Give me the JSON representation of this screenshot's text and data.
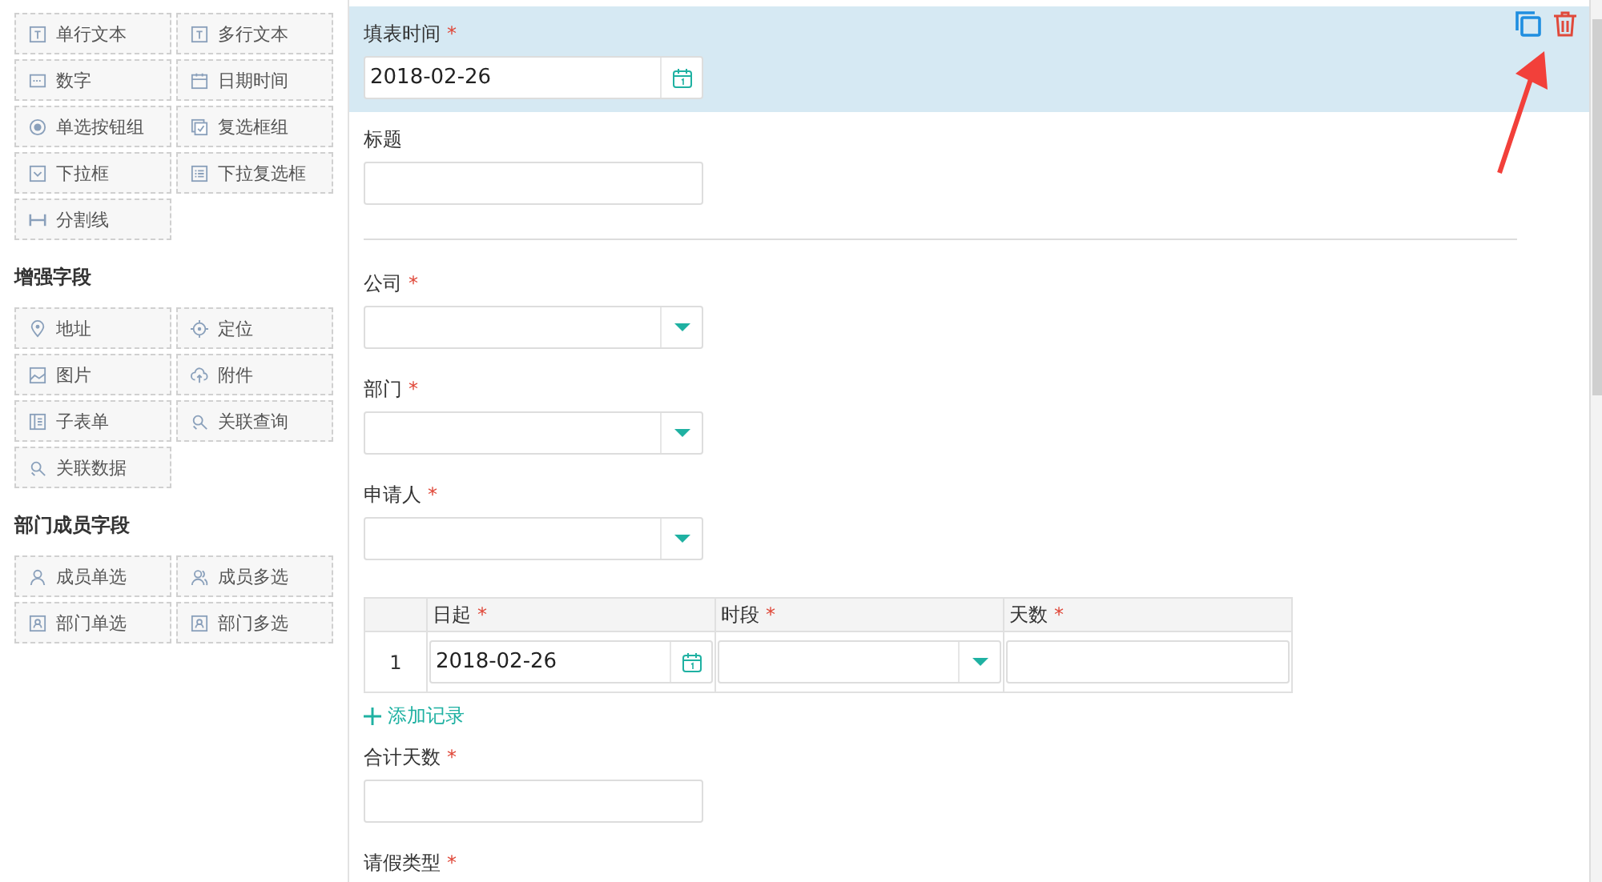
{
  "palette": [
    {
      "items": [
        {
          "label": "单行文本"
        },
        {
          "label": "多行文本"
        },
        {
          "label": "数字"
        },
        {
          "label": "日期时间"
        },
        {
          "label": "单选按钮组"
        },
        {
          "label": "复选框组"
        },
        {
          "label": "下拉框"
        },
        {
          "label": "下拉复选框"
        },
        {
          "label": "分割线"
        }
      ]
    },
    {
      "title": "增强字段",
      "items": [
        {
          "label": "地址"
        },
        {
          "label": "定位"
        },
        {
          "label": "图片"
        },
        {
          "label": "附件"
        },
        {
          "label": "子表单"
        },
        {
          "label": "关联查询"
        },
        {
          "label": "关联数据"
        }
      ]
    },
    {
      "title": "部门成员字段",
      "items": [
        {
          "label": "成员单选"
        },
        {
          "label": "成员多选"
        },
        {
          "label": "部门单选"
        },
        {
          "label": "部门多选"
        }
      ]
    }
  ],
  "form": [
    {
      "kind": "date",
      "label": "填表时间",
      "required_mark": "*",
      "value": "2018-02-26",
      "selected": true
    },
    {
      "kind": "text",
      "label": "标题",
      "selected": false
    },
    {
      "kind": "divider"
    },
    {
      "kind": "select",
      "label": "公司",
      "required_mark": "*",
      "selected": false
    },
    {
      "kind": "select",
      "label": "部门",
      "required_mark": "*",
      "selected": false
    },
    {
      "kind": "select",
      "label": "申请人",
      "required_mark": "*",
      "selected": false
    },
    {
      "kind": "table",
      "columns": [
        {
          "label": "日起",
          "required_mark": "*",
          "kind": "date"
        },
        {
          "label": "时段",
          "required_mark": "*",
          "kind": "select"
        },
        {
          "label": "天数",
          "required_mark": "*",
          "kind": "text"
        }
      ],
      "rows": [
        {
          "number": "1",
          "values": [
            "2018-02-26"
          ]
        }
      ],
      "add_label": "添加记录"
    },
    {
      "kind": "text",
      "label": "合计天数",
      "required_mark": "*",
      "selected": false
    },
    {
      "kind": "label",
      "label": "请假类型",
      "required_mark": "*",
      "selected": false
    }
  ]
}
